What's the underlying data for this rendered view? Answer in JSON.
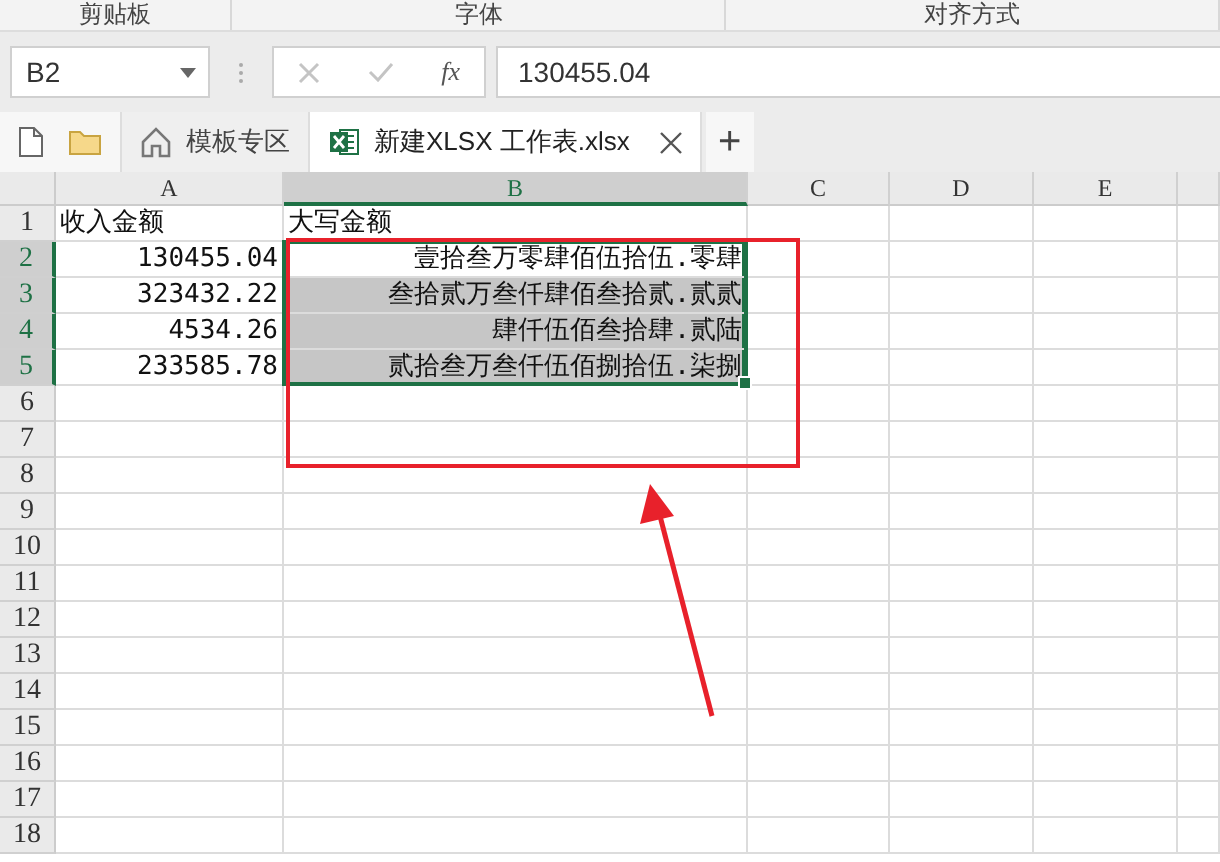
{
  "ribbon_groups": [
    {
      "label": "剪贴板"
    },
    {
      "label": "字体"
    },
    {
      "label": "对齐方式"
    }
  ],
  "formula_bar": {
    "name_box": "B2",
    "function_label": "fx",
    "value": "130455.04"
  },
  "tabs": [
    {
      "label": "模板专区",
      "kind": "home",
      "selected": false
    },
    {
      "label": "新建XLSX 工作表.xlsx",
      "kind": "workbook",
      "selected": true
    }
  ],
  "new_tab": "+",
  "sheet": {
    "columns": [
      {
        "label": "A",
        "selected": false
      },
      {
        "label": "B",
        "selected": true
      },
      {
        "label": "C",
        "selected": false
      },
      {
        "label": "D",
        "selected": false
      },
      {
        "label": "E",
        "selected": false
      }
    ],
    "rows": [
      {
        "header": "1",
        "selected": false,
        "cells": [
          {
            "text": "收入金额",
            "kind": "text"
          },
          {
            "text": "大写金额",
            "kind": "text"
          }
        ]
      },
      {
        "header": "2",
        "selected": true,
        "cells": [
          {
            "text": "130455.04",
            "kind": "number"
          },
          {
            "text": "壹拾叁万零肆佰伍拾伍.零肆",
            "kind": "number"
          }
        ]
      },
      {
        "header": "3",
        "selected": true,
        "cells": [
          {
            "text": "323432.22",
            "kind": "number"
          },
          {
            "text": "叁拾贰万叁仟肆佰叁拾贰.贰贰",
            "kind": "number"
          }
        ]
      },
      {
        "header": "4",
        "selected": true,
        "cells": [
          {
            "text": "4534.26",
            "kind": "number"
          },
          {
            "text": "肆仟伍佰叁拾肆.贰陆",
            "kind": "number"
          }
        ]
      },
      {
        "header": "5",
        "selected": true,
        "cells": [
          {
            "text": "233585.78",
            "kind": "number"
          },
          {
            "text": "贰拾叁万叁仟伍佰捌拾伍.柒捌",
            "kind": "number"
          }
        ]
      },
      {
        "header": "6",
        "selected": false,
        "cells": []
      },
      {
        "header": "7",
        "selected": false,
        "cells": []
      },
      {
        "header": "8",
        "selected": false,
        "cells": []
      },
      {
        "header": "9",
        "selected": false,
        "cells": []
      },
      {
        "header": "10",
        "selected": false,
        "cells": []
      },
      {
        "header": "11",
        "selected": false,
        "cells": []
      },
      {
        "header": "12",
        "selected": false,
        "cells": []
      },
      {
        "header": "13",
        "selected": false,
        "cells": []
      },
      {
        "header": "14",
        "selected": false,
        "cells": []
      },
      {
        "header": "15",
        "selected": false,
        "cells": []
      },
      {
        "header": "16",
        "selected": false,
        "cells": []
      },
      {
        "header": "17",
        "selected": false,
        "cells": []
      },
      {
        "header": "18",
        "selected": false,
        "cells": []
      }
    ]
  }
}
